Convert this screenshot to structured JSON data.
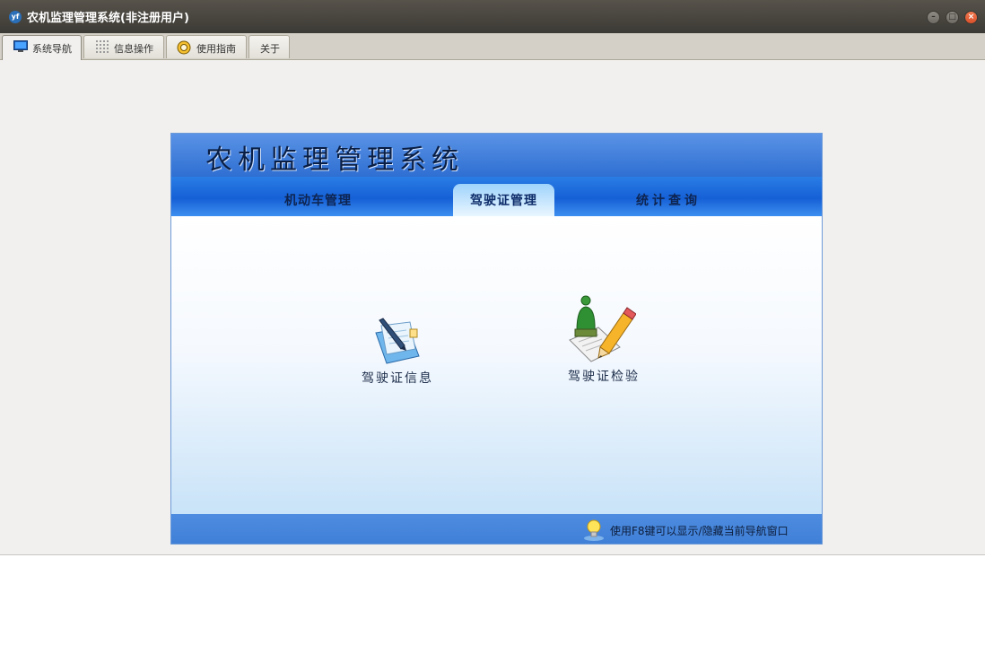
{
  "window": {
    "title": "农机监理管理系统(非注册用户)",
    "controls": [
      "minimize-icon",
      "maximize-icon",
      "close-icon"
    ]
  },
  "tabs": [
    {
      "label": "系统导航",
      "icon": "monitor-icon",
      "active": true
    },
    {
      "label": "信息操作",
      "icon": "grid-icon",
      "active": false
    },
    {
      "label": "使用指南",
      "icon": "lifebuoy-icon",
      "active": false
    },
    {
      "label": "关于",
      "icon": "",
      "active": false
    }
  ],
  "panel": {
    "system_title": "农机监理管理系统",
    "nav": [
      {
        "label": "机动车管理",
        "active": false
      },
      {
        "label": "驾驶证管理",
        "active": true
      },
      {
        "label": "统计查询",
        "active": false
      }
    ],
    "functions": [
      {
        "label": "驾驶证信息",
        "icon": "document-pen-icon"
      },
      {
        "label": "驾驶证检验",
        "icon": "user-checklist-icon"
      }
    ],
    "footer_tip": "使用F8键可以显示/隐藏当前导航窗口",
    "footer_icon": "lightbulb-icon"
  },
  "colors": {
    "titlebar": "#3c3a35",
    "banner": "#2f6fd2",
    "navbar": "#1560d6",
    "footer": "#4d8ce0",
    "close_button": "#d9502a"
  }
}
